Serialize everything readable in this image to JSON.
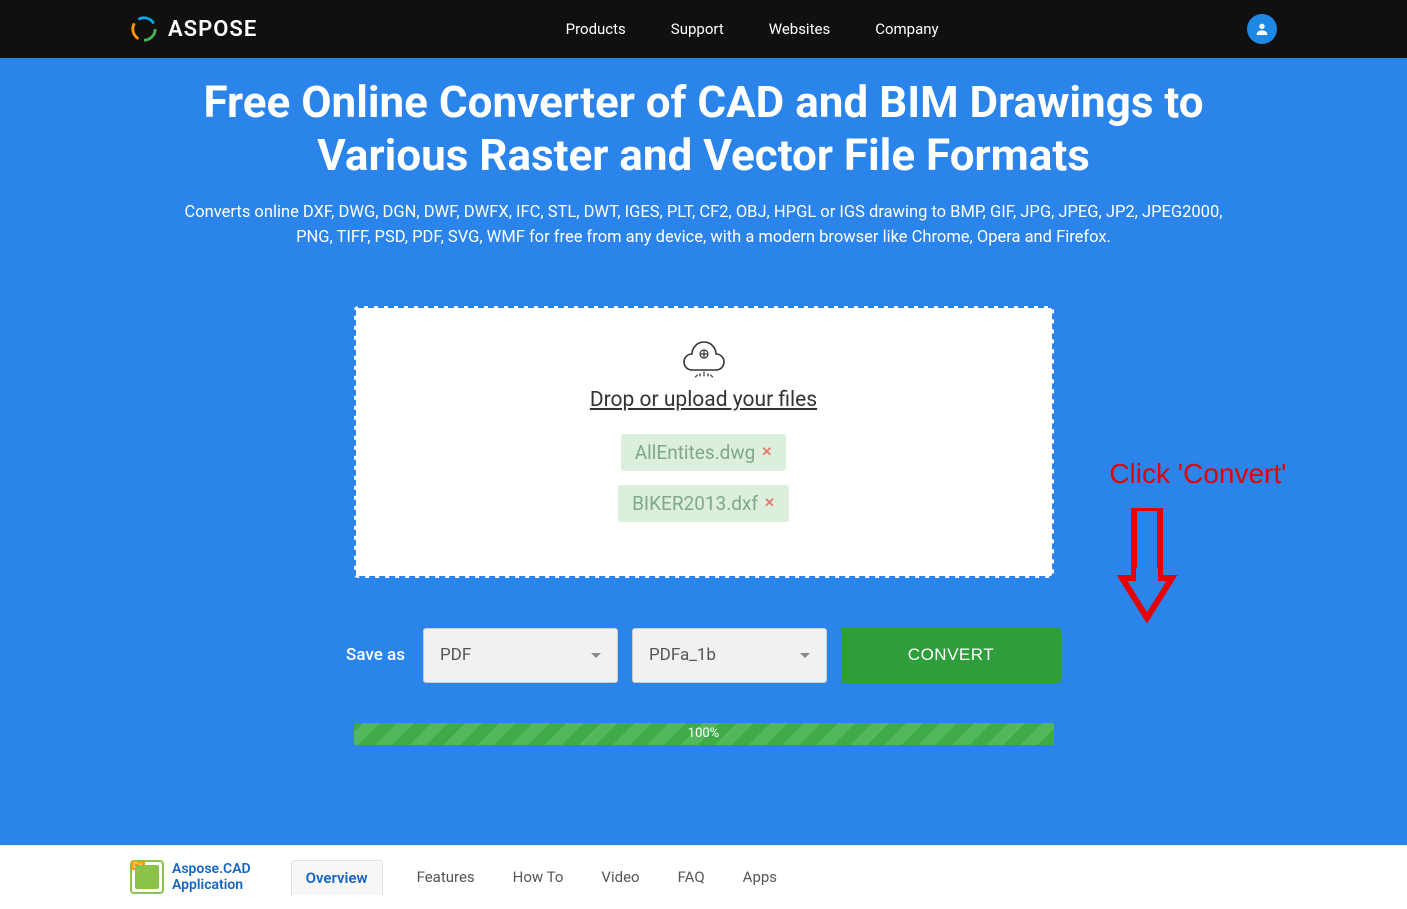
{
  "topbar": {
    "brand": "ASPOSE",
    "nav": [
      "Products",
      "Support",
      "Websites",
      "Company"
    ]
  },
  "hero": {
    "title": "Free Online Converter of CAD and BIM Drawings to Various Raster and Vector File Formats",
    "subtitle": "Converts online DXF, DWG, DGN, DWF, DWFX, IFC, STL, DWT, IGES, PLT, CF2, OBJ, HPGL or IGS drawing to BMP, GIF, JPG, JPEG, JP2, JPEG2000, PNG, TIFF, PSD, PDF, SVG, WMF for free from any device, with a modern browser like Chrome, Opera and Firefox."
  },
  "dropzone": {
    "label": "Drop or upload your files",
    "files": [
      "AllEntites.dwg",
      "BIKER2013.dxf"
    ]
  },
  "annotation": "Click 'Convert'",
  "controls": {
    "save_as_label": "Save as",
    "format": "PDF",
    "subformat": "PDFa_1b",
    "convert_label": "CONVERT"
  },
  "progress": {
    "text": "100%"
  },
  "footer": {
    "app_title": "Aspose.CAD",
    "app_sub": "Application",
    "tabs": [
      "Overview",
      "Features",
      "How To",
      "Video",
      "FAQ",
      "Apps"
    ],
    "active_tab": 0
  }
}
